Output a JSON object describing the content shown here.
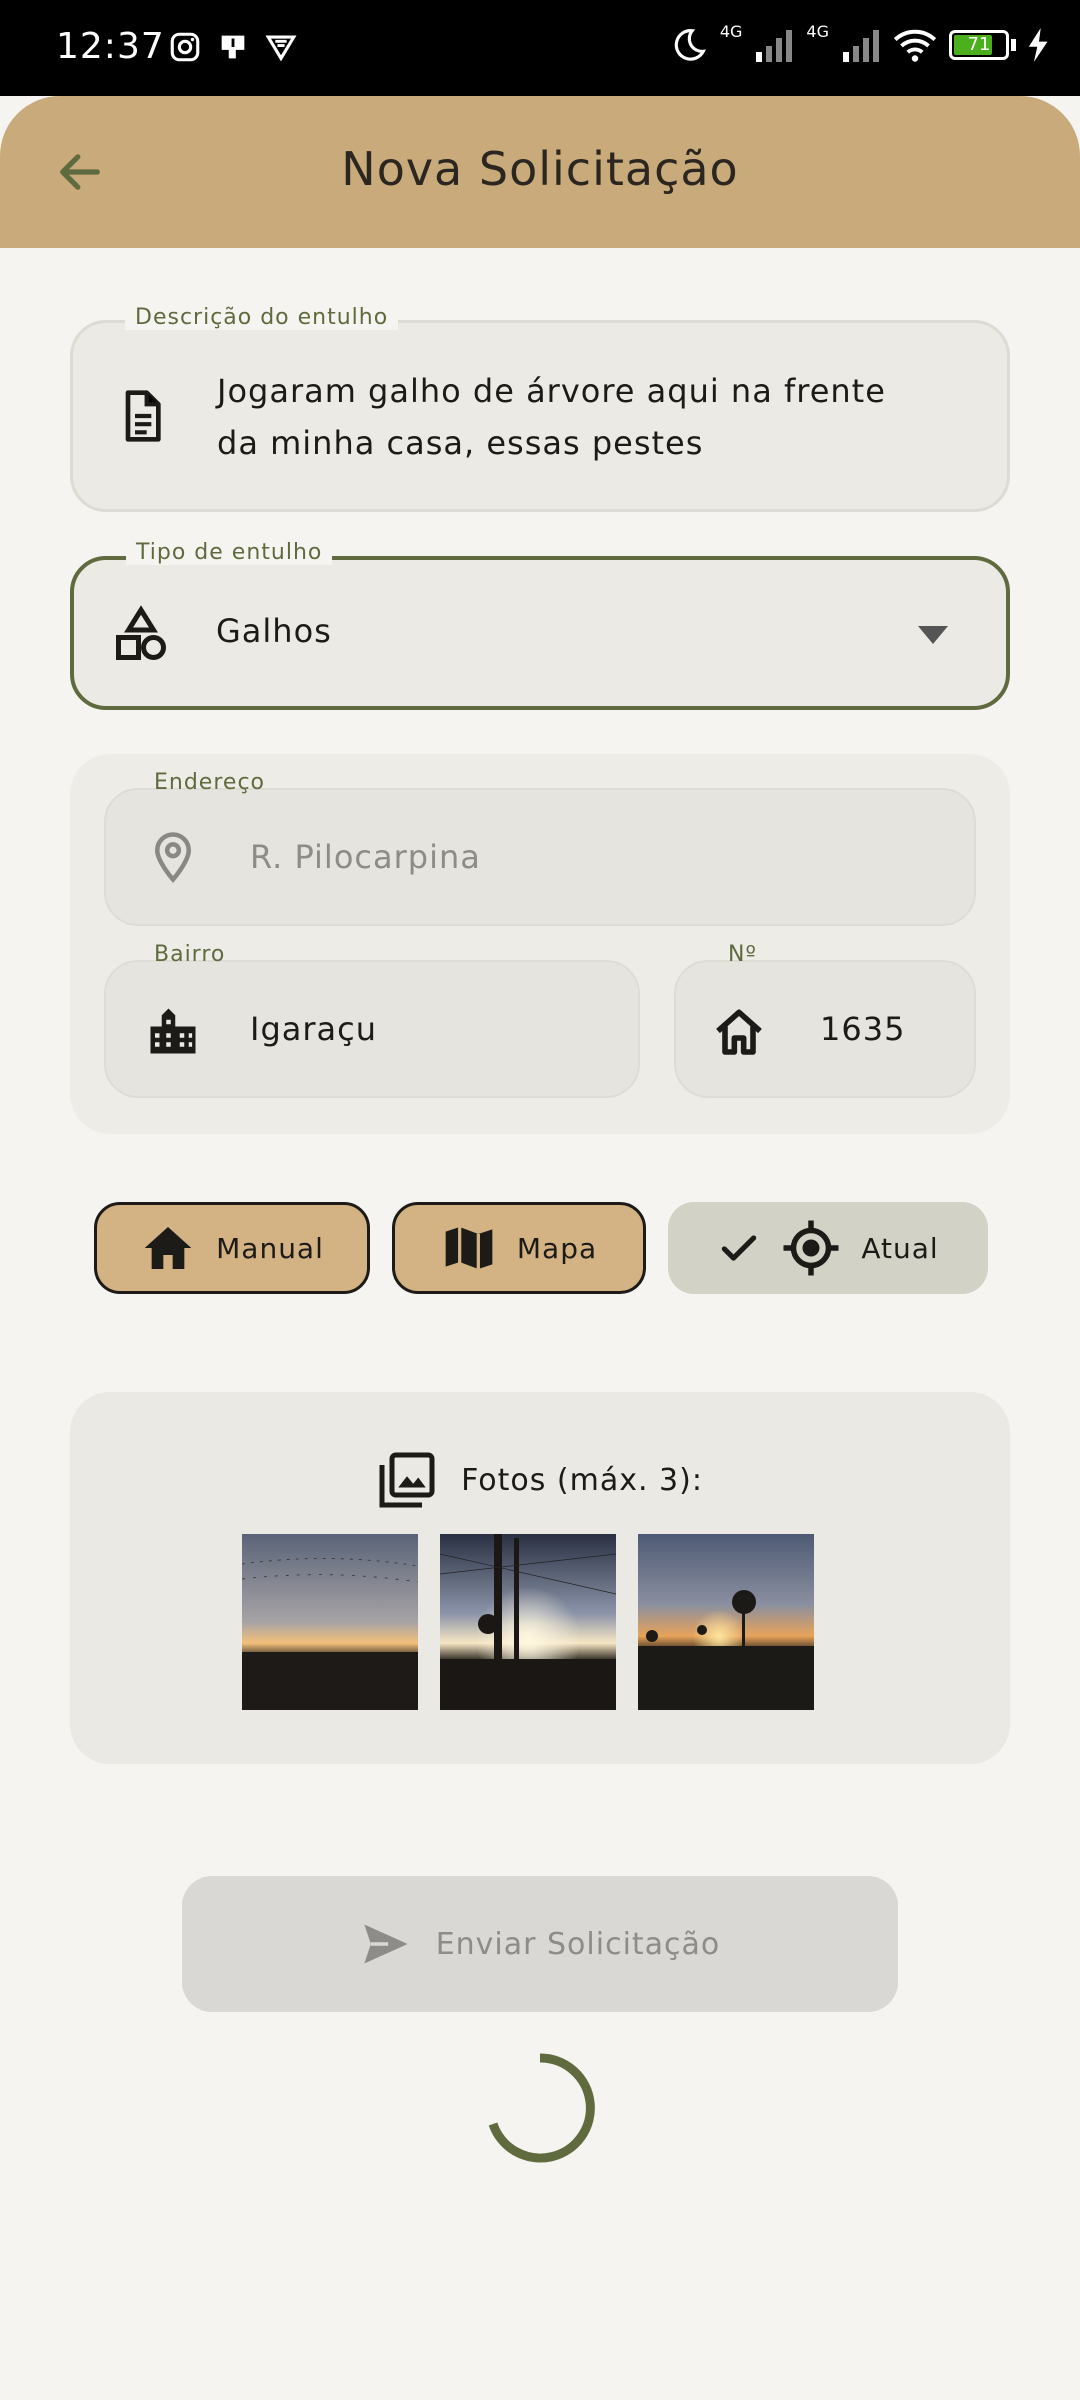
{
  "status_bar": {
    "time": "12:37",
    "network_1": "4G",
    "network_2": "4G",
    "battery": "71"
  },
  "app_bar": {
    "title": "Nova Solicitação"
  },
  "form": {
    "description": {
      "label": "Descrição do entulho",
      "value": "Jogaram galho de árvore aqui na frente da minha casa, essas pestes"
    },
    "debris_type": {
      "label": "Tipo de entulho",
      "value": "Galhos"
    },
    "address": {
      "label": "Endereço",
      "value": "R. Pilocarpina"
    },
    "neighborhood": {
      "label": "Bairro",
      "value": "Igaraçu"
    },
    "number": {
      "label": "Nº",
      "value": "1635"
    }
  },
  "location_modes": {
    "manual": "Manual",
    "map": "Mapa",
    "current": "Atual",
    "selected": "current"
  },
  "photos": {
    "title": "Fotos (máx. 3):",
    "count": 3
  },
  "submit": {
    "label": "Enviar Solicitação"
  },
  "colors": {
    "app_bar": "#c8aa7b",
    "accent_green": "#5f6b3e",
    "tan_button": "#d3b283",
    "background": "#f6f4f0"
  }
}
